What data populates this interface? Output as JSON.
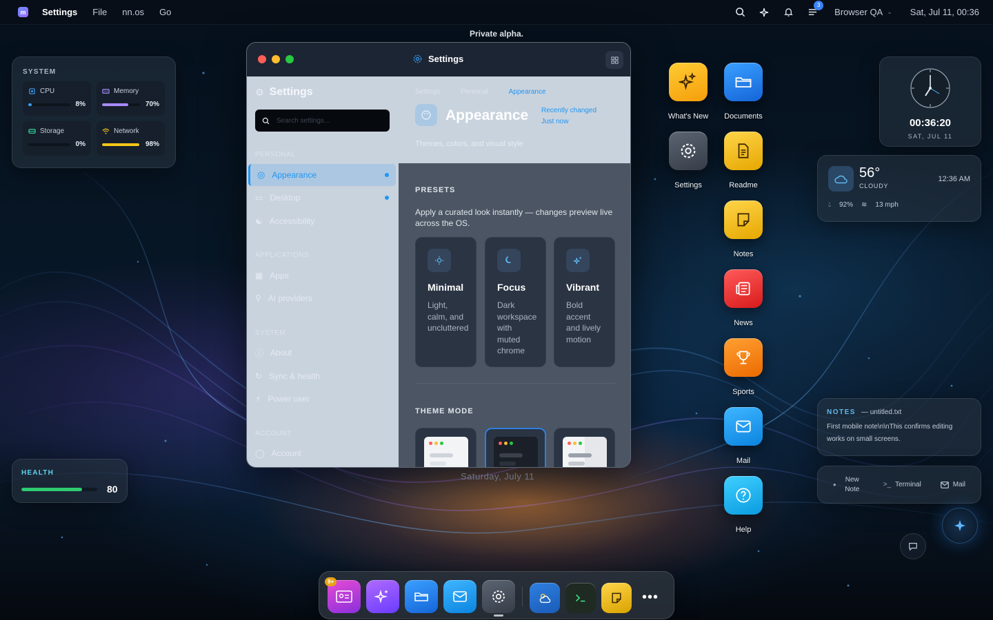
{
  "menubar": {
    "app_name": "Settings",
    "menus": [
      "File",
      "nn.os",
      "Go"
    ],
    "notification_count": "3",
    "profile": "Browser QA",
    "datetime": "Sat, Jul 11, 00:36"
  },
  "banner": "Private alpha.",
  "system_widget": {
    "title": "SYSTEM",
    "cells": [
      {
        "label": "CPU",
        "value": "8%",
        "level": 0.08,
        "color": "#3b9cf0",
        "icon": "cpu-icon"
      },
      {
        "label": "Memory",
        "value": "70%",
        "level": 0.7,
        "color": "#a78bfa",
        "icon": "memory-icon"
      },
      {
        "label": "Storage",
        "value": "0%",
        "level": 0.0,
        "color": "#34d399",
        "icon": "storage-icon"
      },
      {
        "label": "Network",
        "value": "98%",
        "level": 0.98,
        "color": "#f5c518",
        "icon": "wifi-icon"
      }
    ]
  },
  "health_widget": {
    "title": "HEALTH",
    "value": "80",
    "level": 0.8
  },
  "settings_window": {
    "title": "Settings",
    "sidebar": {
      "title": "Settings",
      "search_placeholder": "Search settings...",
      "sections": {
        "personal": "PERSONAL",
        "applications": "APPLICATIONS",
        "system": "SYSTEM",
        "account": "ACCOUNT"
      },
      "items": {
        "appearance": "Appearance",
        "desktop": "Desktop",
        "accessibility": "Accessibility",
        "apps": "Apps",
        "ai_providers": "AI providers",
        "about": "About",
        "sync": "Sync & health",
        "power_user": "Power user",
        "account": "Account"
      }
    },
    "header": {
      "breadcrumbs": [
        "Settings",
        "Personal",
        "Appearance"
      ],
      "title": "Appearance",
      "meta_1": "Recently changed",
      "meta_2": "Just now",
      "subtitle": "Themes, colors, and visual style"
    },
    "presets": {
      "label": "PRESETS",
      "description": "Apply a curated look instantly — changes preview live across the OS.",
      "items": [
        {
          "name": "Minimal",
          "desc": "Light, calm, and uncluttered",
          "icon": "sun-icon"
        },
        {
          "name": "Focus",
          "desc": "Dark workspace with muted chrome",
          "icon": "moon-icon"
        },
        {
          "name": "Vibrant",
          "desc": "Bold accent and lively motion",
          "icon": "sparkles-icon"
        }
      ]
    },
    "theme_mode": {
      "label": "THEME MODE"
    }
  },
  "desktop_date": "Saturday, July 11",
  "desktop_icons": {
    "whats_new": "What's New",
    "documents": "Documents",
    "settings": "Settings",
    "readme": "Readme",
    "notes": "Notes",
    "news": "News",
    "sports": "Sports",
    "mail": "Mail",
    "help": "Help"
  },
  "clock_widget": {
    "time": "00:36:20",
    "date": "SAT, JUL 11"
  },
  "weather_widget": {
    "temp": "56°",
    "condition": "CLOUDY",
    "time": "12:36 AM",
    "humidity": "92%",
    "wind": "13 mph"
  },
  "notes_widget": {
    "title": "NOTES",
    "file": "— untitled.txt",
    "body": "First mobile note\\n\\nThis confirms editing works on small screens."
  },
  "quick_actions": {
    "new_note": "New Note",
    "terminal": "Terminal",
    "mail": "Mail"
  },
  "dock": {
    "badge": "9+",
    "apps": [
      "contacts-icon",
      "sparkles-icon",
      "folder-icon",
      "mail-icon",
      "gear-icon",
      "weather-icon",
      "terminal-icon",
      "notes-icon",
      "more-icon"
    ]
  },
  "colors": {
    "accent": "#2196f3",
    "health": "#2ecc71",
    "menubar": "#080e18"
  }
}
